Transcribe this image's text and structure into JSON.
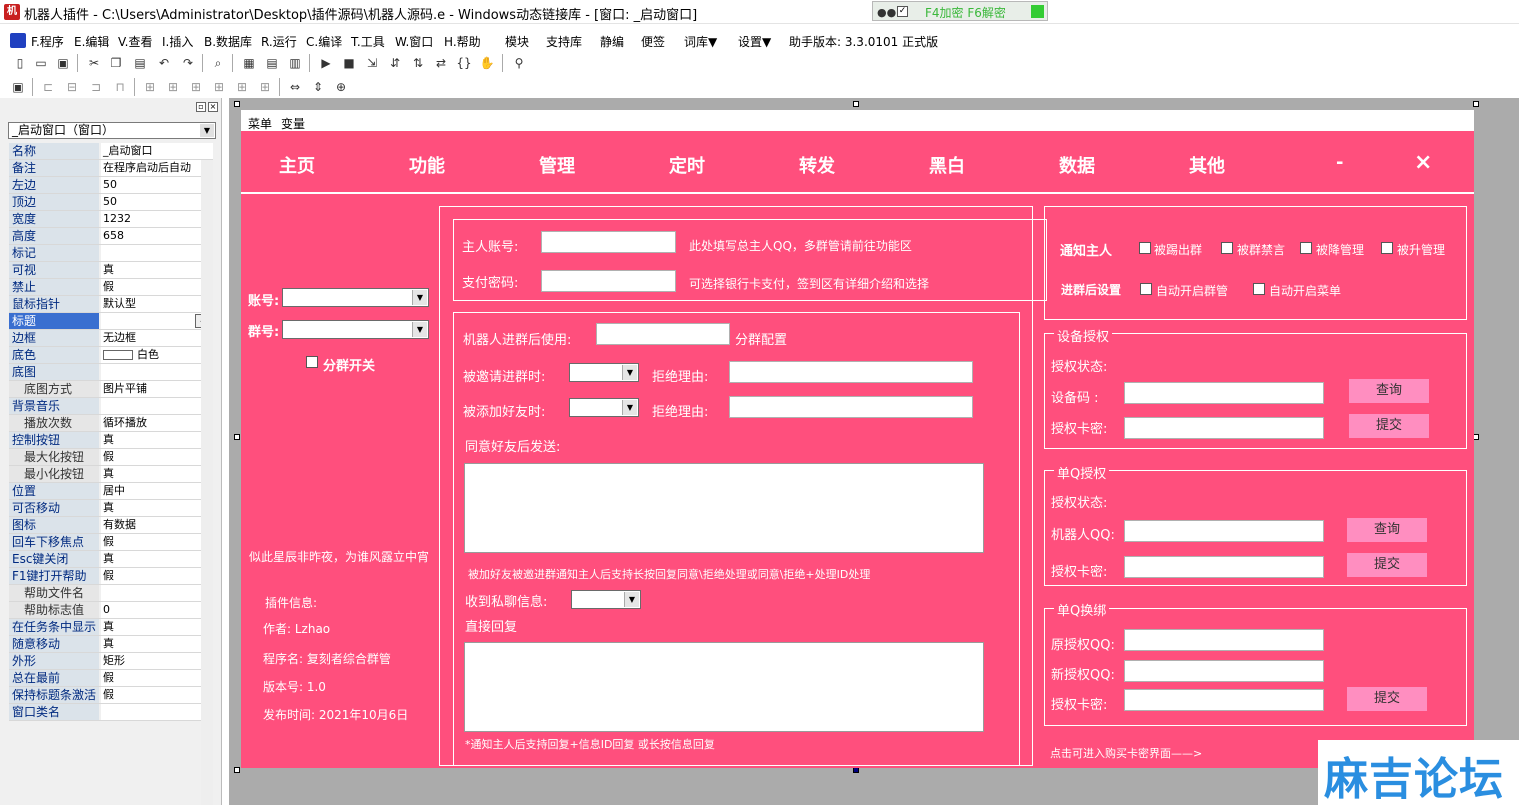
{
  "titlebar": {
    "text": "机器人插件 - C:\\Users\\Administrator\\Desktop\\插件源码\\机器人源码.e - Windows动态链接库 - [窗口: _启动窗口]",
    "f4_text": "F4加密 F6解密"
  },
  "menu": {
    "items": [
      "F.程序",
      "E.编辑",
      "V.查看",
      "I.插入",
      "B.数据库",
      "R.运行",
      "C.编译",
      "T.工具",
      "W.窗口",
      "H.帮助",
      "模块",
      "支持库",
      "静编",
      "便签",
      "词库▼",
      "设置▼",
      "助手版本: 3.3.0101 正式版"
    ]
  },
  "props": {
    "object_select": "_启动窗口（窗口）",
    "rows": [
      {
        "k": "名称",
        "v": "_启动窗口",
        "indent": false
      },
      {
        "k": "备注",
        "v": "在程序启动后自动",
        "indent": false
      },
      {
        "k": "左边",
        "v": "50",
        "indent": false
      },
      {
        "k": "顶边",
        "v": "50",
        "indent": false
      },
      {
        "k": "宽度",
        "v": "1232",
        "indent": false
      },
      {
        "k": "高度",
        "v": "658",
        "indent": false
      },
      {
        "k": "标记",
        "v": "",
        "indent": false
      },
      {
        "k": "可视",
        "v": "真",
        "indent": false
      },
      {
        "k": "禁止",
        "v": "假",
        "indent": false
      },
      {
        "k": "鼠标指针",
        "v": "默认型",
        "indent": false
      },
      {
        "k": "标题",
        "v": "",
        "indent": false,
        "selected": true
      },
      {
        "k": "边框",
        "v": "无边框",
        "indent": false
      },
      {
        "k": "底色",
        "v": "白色",
        "indent": false,
        "swatch": true
      },
      {
        "k": "底图",
        "v": "",
        "indent": false
      },
      {
        "k": "底图方式",
        "v": "图片平铺",
        "indent": true
      },
      {
        "k": "背景音乐",
        "v": "",
        "indent": false
      },
      {
        "k": "播放次数",
        "v": "循环播放",
        "indent": true
      },
      {
        "k": "控制按钮",
        "v": "真",
        "indent": false
      },
      {
        "k": "最大化按钮",
        "v": "假",
        "indent": true
      },
      {
        "k": "最小化按钮",
        "v": "真",
        "indent": true
      },
      {
        "k": "位置",
        "v": "居中",
        "indent": false
      },
      {
        "k": "可否移动",
        "v": "真",
        "indent": false
      },
      {
        "k": "图标",
        "v": "有数据",
        "indent": false
      },
      {
        "k": "回车下移焦点",
        "v": "假",
        "indent": false
      },
      {
        "k": "Esc键关闭",
        "v": "真",
        "indent": false
      },
      {
        "k": "F1键打开帮助",
        "v": "假",
        "indent": false
      },
      {
        "k": "帮助文件名",
        "v": "",
        "indent": true
      },
      {
        "k": "帮助标志值",
        "v": "0",
        "indent": true
      },
      {
        "k": "在任务条中显示",
        "v": "真",
        "indent": false
      },
      {
        "k": "随意移动",
        "v": "真",
        "indent": false
      },
      {
        "k": "外形",
        "v": "矩形",
        "indent": false
      },
      {
        "k": "总在最前",
        "v": "假",
        "indent": false
      },
      {
        "k": "保持标题条激活",
        "v": "假",
        "indent": false
      },
      {
        "k": "窗口类名",
        "v": "",
        "indent": false
      }
    ]
  },
  "form": {
    "topbar": {
      "menu": "菜单",
      "var": "变量"
    },
    "nav": [
      "主页",
      "功能",
      "管理",
      "定时",
      "转发",
      "黑白",
      "数据",
      "其他",
      "-",
      "×"
    ],
    "left": {
      "account_label": "账号:",
      "group_label": "群号:",
      "split_switch": "分群开关",
      "motto": "似此星辰非昨夜，为谁风露立中宵",
      "plugin_info": "插件信息:",
      "author": "作者: Lzhao",
      "program": "程序名: 复刻者综合群管",
      "version": "版本号: 1.0",
      "release": "发布时间: 2021年10月6日"
    },
    "middle": {
      "owner_label": "主人账号:",
      "owner_hint": "此处填写总主人QQ，多群管请前往功能区",
      "pay_label": "支付密码:",
      "pay_hint": "可选择银行卡支付，签到区有详细介绍和选择",
      "robot_use_label": "机器人进群后使用:",
      "split_config": "分群配置",
      "invited_label": "被邀请进群时:",
      "reject_reason1": "拒绝理由:",
      "added_label": "被添加好友时:",
      "reject_reason2": "拒绝理由:",
      "agree_send": "同意好友后发送:",
      "note1": "被加好友被邀进群通知主人后支持长按回复同意\\拒绝处理或同意\\拒绝+处理ID处理",
      "private_msg": "收到私聊信息:",
      "direct_reply": "直接回复",
      "note2": "*通知主人后支持回复+信息ID回复 或长按信息回复"
    },
    "right": {
      "notify_owner": "通知主人",
      "cb_kicked": "被踢出群",
      "cb_muted": "被群禁言",
      "cb_demoted": "被降管理",
      "cb_promoted": "被升管理",
      "join_settings": "进群后设置",
      "cb_auto_admin": "自动开启群管",
      "cb_auto_menu": "自动开启菜单",
      "device_group": "设备授权",
      "device_status": "授权状态:",
      "device_code": "设备码  :",
      "device_key": "授权卡密:",
      "btn_query1": "查询",
      "btn_submit1": "提交",
      "single_group": "单Q授权",
      "single_status": "授权状态:",
      "robot_qq": "机器人QQ:",
      "single_key": "授权卡密:",
      "btn_query2": "查询",
      "btn_submit2": "提交",
      "change_group": "单Q换绑",
      "orig_qq": "原授权QQ:",
      "new_qq": "新授权QQ:",
      "change_key": "授权卡密:",
      "btn_submit3": "提交",
      "buy_link": "点击可进入购买卡密界面——>"
    }
  },
  "watermark": "麻吉论坛",
  "colors": {
    "form_bg": "#ff4f7d",
    "button_pink": "#ff8ec0",
    "designer_bg": "#ababab"
  }
}
